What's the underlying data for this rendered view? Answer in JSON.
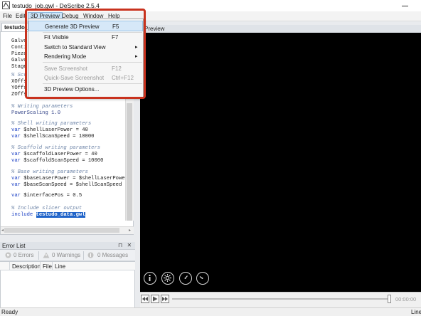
{
  "window": {
    "title": "testudo_job.gwl - DeScribe 2.5.4",
    "colors": {
      "accent": "#c8321e",
      "selection": "#1f63c9",
      "preview_bg": "#000000"
    }
  },
  "menubar": {
    "items": [
      "File",
      "Edit",
      "3D Preview",
      "Debug",
      "Window",
      "Help"
    ]
  },
  "preview_menu": {
    "items": [
      {
        "label": "Generate 3D Preview",
        "shortcut": "F5",
        "enabled": true,
        "highlighted": true
      },
      {
        "label": "Fit Visible",
        "shortcut": "F7",
        "enabled": true
      },
      {
        "label": "Switch to Standard View",
        "submenu": true,
        "enabled": true
      },
      {
        "label": "Rendering Mode",
        "submenu": true,
        "enabled": true
      },
      {
        "label": "Save Screenshot",
        "shortcut": "F12",
        "enabled": false
      },
      {
        "label": "Quick-Save Screenshot",
        "shortcut": "Ctrl+F12",
        "enabled": false
      },
      {
        "label": "3D Preview Options...",
        "enabled": true
      }
    ],
    "submenu_arrow": "▸"
  },
  "editor": {
    "tab_label": "testudo_job.gwl",
    "hidden_partial_lines": [
      "Galvo",
      "Conti",
      "Piezo",
      "Galvo",
      "Stage",
      "% Scr",
      "XOffs",
      "YOffs",
      "ZOffs"
    ],
    "visible_lines": [
      {
        "type": "comment",
        "text": "% Writing parameters"
      },
      {
        "type": "plain",
        "text": "PowerScaling 1.0"
      },
      {
        "type": "blank",
        "text": ""
      },
      {
        "type": "comment",
        "text": "% Shell writing parameters"
      },
      {
        "type": "var",
        "kw": "var",
        "text": " $shellLaserPower = 40"
      },
      {
        "type": "var",
        "kw": "var",
        "text": " $shellScanSpeed = 10000"
      },
      {
        "type": "blank",
        "text": ""
      },
      {
        "type": "comment",
        "text": "% Scaffold writing parameters"
      },
      {
        "type": "var",
        "kw": "var",
        "text": " $scaffoldLaserPower = 40"
      },
      {
        "type": "var",
        "kw": "var",
        "text": " $scaffoldScanSpeed = 10000"
      },
      {
        "type": "blank",
        "text": ""
      },
      {
        "type": "comment",
        "text": "% Base writing parameters"
      },
      {
        "type": "var",
        "kw": "var",
        "text": " $baseLaserPower = $shellLaserPower"
      },
      {
        "type": "var",
        "kw": "var",
        "text": " $baseScanSpeed = $shellScanSpeed"
      },
      {
        "type": "blank",
        "text": ""
      },
      {
        "type": "var",
        "kw": "var",
        "text": " $interfacePos = 0.5"
      },
      {
        "type": "blank",
        "text": ""
      },
      {
        "type": "comment",
        "text": "% Include slicer output"
      },
      {
        "type": "include",
        "kw": "include",
        "text": "testudo_data.gwl"
      }
    ]
  },
  "error_list": {
    "title": "Error List",
    "errors": "0 Errors",
    "warnings": "0 Warnings",
    "messages": "0 Messages",
    "columns": [
      "Description",
      "File",
      "Line"
    ],
    "pin_icon": "⊓",
    "close_icon": "✕"
  },
  "preview": {
    "title": "Preview",
    "time": "00:00:00",
    "tools": [
      "info-icon",
      "settings-icon",
      "speedometer-icon",
      "gauge-icon"
    ]
  },
  "statusbar": {
    "left": "Ready",
    "right": "Line"
  }
}
